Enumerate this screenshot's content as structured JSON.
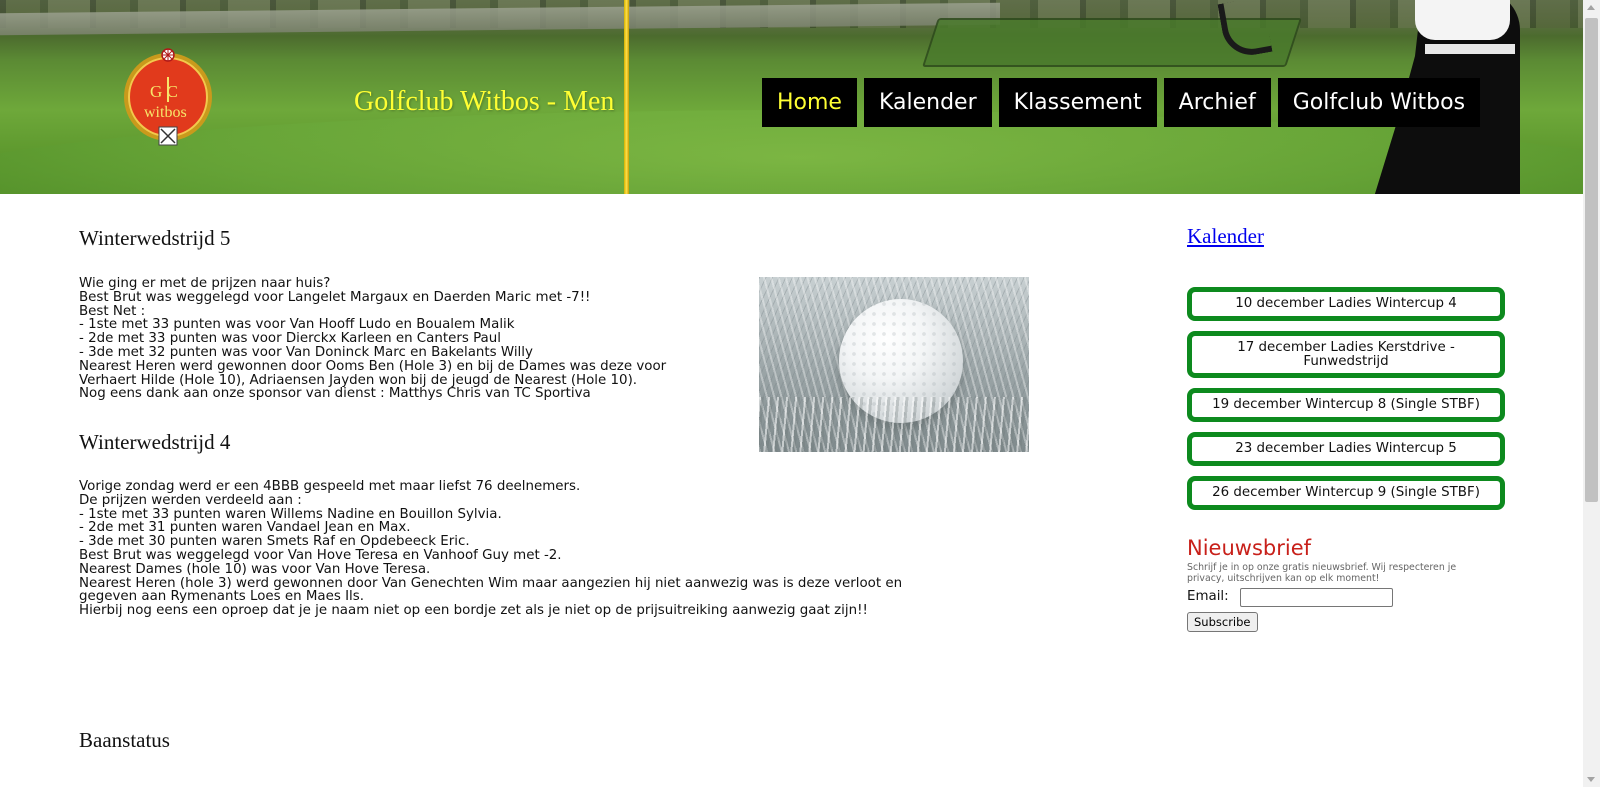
{
  "header": {
    "site_title": "Golfclub Witbos - Men",
    "logo": {
      "letters": "G C",
      "text": "witbos"
    },
    "nav": [
      {
        "label": "Home",
        "active": true
      },
      {
        "label": "Kalender",
        "active": false
      },
      {
        "label": "Klassement",
        "active": false
      },
      {
        "label": "Archief",
        "active": false
      },
      {
        "label": "Golfclub Witbos",
        "active": false
      }
    ]
  },
  "articles": [
    {
      "title": "Winterwedstrijd 5",
      "lines": [
        "Wie ging er met de prijzen naar huis?",
        "Best Brut was weggelegd voor Langelet Margaux en Daerden Maric met -7!!",
        "Best Net :",
        "- 1ste met 33 punten was voor Van Hooff Ludo en Boualem Malik",
        "- 2de met 33 punten was voor Dierckx Karleen en Canters Paul",
        "- 3de met 32 punten was voor Van Doninck Marc en Bakelants Willy",
        "Nearest Heren werd gewonnen door Ooms Ben (Hole 3) en bij de Dames was deze voor",
        "Verhaert Hilde (Hole 10), Adriaensen Jayden won bij de jeugd de Nearest (Hole 10).",
        "Nog eens dank aan onze sponsor van dienst : Matthys Chris van TC Sportiva"
      ]
    },
    {
      "title": "Winterwedstrijd 4",
      "lines": [
        "Vorige zondag werd er een 4BBB gespeeld met maar liefst 76 deelnemers.",
        "De prijzen werden verdeeld aan :",
        "- 1ste met 33 punten waren Willems Nadine en Bouillon Sylvia.",
        "- 2de met 31 punten waren Vandael Jean en Max.",
        "- 3de met 30 punten waren Smets Raf en Opdebeeck Eric.",
        "Best Brut was weggelegd voor Van Hove Teresa en Vanhoof Guy met -2.",
        "Nearest Dames (hole 10) was voor Van Hove Teresa.",
        "Nearest Heren (hole 3) werd gewonnen door Van Genechten Wim maar aangezien hij niet aanwezig was is deze verloot en",
        "gegeven aan Rymenants Loes en Maes Ils.",
        "Hierbij nog eens een oproep dat je je naam niet op een bordje zet als je niet op de prijsuitreiking aanwezig gaat zijn!!"
      ]
    },
    {
      "title": "Baanstatus",
      "lines": []
    }
  ],
  "sidebar": {
    "calendar_title": "Kalender",
    "events": [
      "10 december Ladies Wintercup 4",
      "17 december Ladies Kerstdrive - Funwedstrijd",
      "19 december Wintercup 8 (Single STBF)",
      "23 december Ladies Wintercup 5",
      "26 december Wintercup 9 (Single STBF)"
    ],
    "newsletter": {
      "title": "Nieuwsbrief",
      "description": "Schrijf je in op onze gratis nieuwsbrief. Wij respecteren je privacy, uitschrijven kan op elk moment!",
      "email_label": "Email:",
      "email_value": "",
      "subscribe_label": "Subscribe"
    }
  },
  "colors": {
    "title_yellow": "#ffff33",
    "nav_bg": "#000000",
    "event_border": "#0d8a1e",
    "newsletter_red": "#c8201a",
    "link_blue": "#0000ee"
  }
}
